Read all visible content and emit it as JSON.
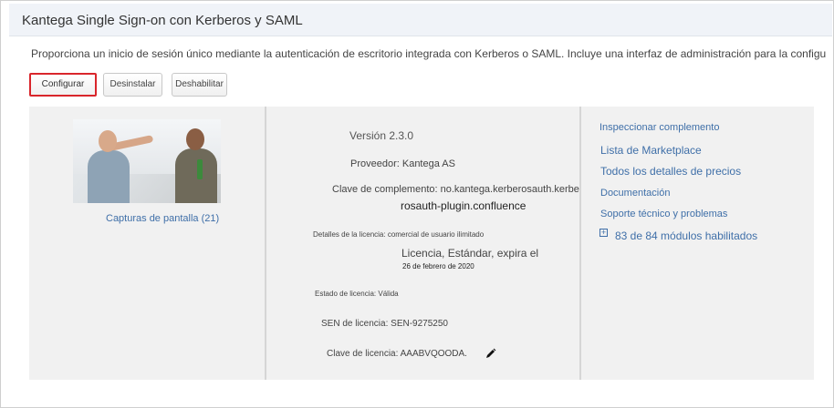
{
  "header": {
    "title": "Kantega Single Sign-on con Kerberos y SAML"
  },
  "description": "Proporciona un inicio de sesión único mediante la autenticación de escritorio integrada con Kerberos o SAML. Incluye una interfaz de administración para la configu",
  "actions": {
    "configure_label": "Configurar",
    "uninstall_label": "Desinstalar",
    "disable_label": "Deshabilitar"
  },
  "left_column": {
    "screenshots_link": "Capturas de pantalla (21)"
  },
  "details": {
    "version": "Versión 2.3.0",
    "provider": "Proveedor: Kantega AS",
    "addon_key_line1": "Clave de complemento: no.kantega.kerberosauth.kerbe",
    "addon_key_line2": "rosauth-plugin.confluence",
    "license_details": "Detalles de la licencia: comercial de usuario ilimitado",
    "license_text": "Licencia, Estándar, expira el",
    "license_date": "26 de febrero de 2020",
    "license_status": "Estado de licencia: Válida",
    "sen": "SEN de licencia: SEN-9275250",
    "license_key": "Clave de licencia: AAABVQOODA."
  },
  "right_column": {
    "inspect": "Inspeccionar complemento",
    "marketplace": "Lista de Marketplace",
    "pricing": "Todos los detalles de precios",
    "documentation": "Documentación",
    "support": "Soporte técnico y problemas",
    "modules": "83 de 84 módulos habilitados"
  },
  "colors": {
    "link": "#3f6fa8",
    "highlight_border": "#d9252b",
    "panel_bg": "#f1f1f1"
  },
  "icons": {
    "edit": "pencil-icon",
    "expand": "plus-icon"
  }
}
